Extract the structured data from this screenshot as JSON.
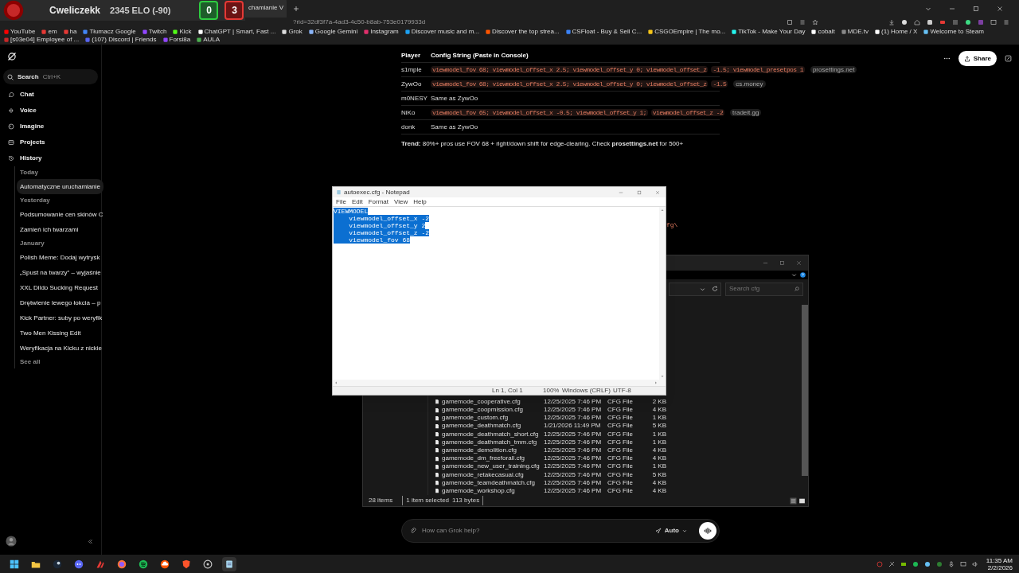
{
  "stream_overlay": {
    "name": "Cweliczekk",
    "elo": "2345 ELO (-90)",
    "wins": "0",
    "losses": "3"
  },
  "browser": {
    "tabs": [
      {
        "title": "chamianie V",
        "selected": true
      }
    ],
    "url": "?rid=32df3f7a-4ad3-4c50-b8ab-753e0179933d",
    "bookmarks": [
      {
        "label": "YouTube",
        "color": "#ff0000"
      },
      {
        "label": "em",
        "color": "#e53935"
      },
      {
        "label": "ha",
        "color": "#e53935"
      },
      {
        "label": "Tłumacz Google",
        "color": "#4285f4"
      },
      {
        "label": "Twitch",
        "color": "#9146ff"
      },
      {
        "label": "Kick",
        "color": "#53fc18"
      },
      {
        "label": "ChatGPT | Smart, Fast ...",
        "color": "#ffffff"
      },
      {
        "label": "Grok",
        "color": "#dddddd"
      },
      {
        "label": "Google Gemini",
        "color": "#8ab4f8"
      },
      {
        "label": "Instagram",
        "color": "#e1306c"
      },
      {
        "label": "Discover music and m...",
        "color": "#1da1f2"
      },
      {
        "label": "Discover the top strea...",
        "color": "#ff5500"
      },
      {
        "label": "CSFloat - Buy & Sell C...",
        "color": "#3b82f6"
      },
      {
        "label": "CSGOEmpire | The mo...",
        "color": "#f5c518"
      },
      {
        "label": "TikTok - Make Your Day",
        "color": "#25f4ee"
      },
      {
        "label": "cobalt",
        "color": "#ffffff"
      },
      {
        "label": "MDE.tv",
        "color": "#888888"
      },
      {
        "label": "(1) Home / X",
        "color": "#ffffff"
      },
      {
        "label": "Welcome to Steam",
        "color": "#66c0f4"
      },
      {
        "label": "[s03e04] Employee of ...",
        "color": "#c62828"
      },
      {
        "label": "(107) Discord | Friends",
        "color": "#5865f2"
      },
      {
        "label": "Forsi8a",
        "color": "#9146ff"
      },
      {
        "label": "AULA",
        "color": "#4caf50"
      }
    ]
  },
  "sidebar": {
    "search": {
      "label": "Search",
      "shortcut": "Ctrl+K"
    },
    "nav": [
      {
        "kind": "chat",
        "label": "Chat"
      },
      {
        "kind": "voice",
        "label": "Voice"
      },
      {
        "kind": "imagine",
        "label": "Imagine"
      },
      {
        "kind": "projects",
        "label": "Projects"
      },
      {
        "kind": "history",
        "label": "History"
      }
    ],
    "history": [
      {
        "heading": "Today",
        "items": [
          {
            "title": "Automatyczne uruchamianie",
            "selected": true
          }
        ]
      },
      {
        "heading": "Yesterday",
        "items": [
          {
            "title": "Podsumowanie cen skinów C",
            "selected": false
          },
          {
            "title": "Zamień ich twarzami",
            "selected": false
          }
        ]
      },
      {
        "heading": "January",
        "items": [
          {
            "title": "Polish Meme: Dodaj wytrysk",
            "selected": false
          },
          {
            "title": "„Spust na twarzy” – wyjaśnie",
            "selected": false
          },
          {
            "title": "XXL Dildo Sucking Request",
            "selected": false
          },
          {
            "title": "Drętwienie lewego łokcia – p",
            "selected": false
          },
          {
            "title": "Kick Partner: suby po weryfik",
            "selected": false
          },
          {
            "title": "Two Men Kissing Edit",
            "selected": false
          },
          {
            "title": "Weryfikacja na Kicku z nickie",
            "selected": false
          }
        ]
      }
    ],
    "see_all": "See all"
  },
  "header": {
    "share": "Share"
  },
  "chat": {
    "table": {
      "columns": [
        "Player",
        "Config String (Paste in Console)"
      ],
      "rows": [
        {
          "player": "s1mple",
          "parts": [
            {
              "kind": "code",
              "text": "viewmodel_fov 68; viewmodel_offset_x 2.5; viewmodel_offset_y 0; viewmodel_offset_z"
            },
            {
              "kind": "code",
              "text": "-1.5; viewmodel_presetpos 1"
            },
            {
              "kind": "source",
              "text": "prosettings.net"
            }
          ]
        },
        {
          "player": "ZywOo",
          "parts": [
            {
              "kind": "code",
              "text": "viewmodel_fov 68; viewmodel_offset_x 2.5; viewmodel_offset_y 0; viewmodel_offset_z"
            },
            {
              "kind": "code",
              "text": "-1.5"
            },
            {
              "kind": "source",
              "text": "cs.money"
            }
          ]
        },
        {
          "player": "m0NESY",
          "parts": [
            {
              "kind": "text",
              "text": "Same as ZywOo"
            }
          ]
        },
        {
          "player": "NiKo",
          "parts": [
            {
              "kind": "code",
              "text": "viewmodel_fov 65; viewmodel_offset_x -0.5; viewmodel_offset_y 1;"
            },
            {
              "kind": "code",
              "text": "viewmodel_offset_z -2"
            },
            {
              "kind": "source",
              "text": "tradeit.gg"
            }
          ]
        },
        {
          "player": "donk",
          "parts": [
            {
              "kind": "text",
              "text": "Same as ZywOo"
            }
          ]
        }
      ]
    },
    "trend": "**Trend:** 80%+ pros use FOV 68 + right/down shift for edge-clearing. Check **prosettings.net** for 500+",
    "partial_code": "fg\\"
  },
  "notepad": {
    "title": "autoexec.cfg - Notepad",
    "menu": [
      "File",
      "Edit",
      "Format",
      "View",
      "Help"
    ],
    "lines": [
      {
        "text": "VIEWMODEL",
        "selected": true
      },
      {
        "text": "    viewmodel_offset_x -2",
        "selected": true
      },
      {
        "text": "    viewmodel_offset_y 2",
        "selected": true
      },
      {
        "text": "    viewmodel_offset_z -2",
        "selected": true
      },
      {
        "text": "    viewmodel_fov 68",
        "selected": true
      }
    ],
    "status": [
      "Ln 1, Col 1",
      "100%",
      "Windows (CRLF)",
      "UTF-8"
    ]
  },
  "explorer": {
    "search_placeholder": "Search cfg",
    "files": [
      {
        "name": "gamemode_cooperative.cfg",
        "date": "12/25/2025 7:46 PM",
        "type": "CFG File",
        "size": "2 KB"
      },
      {
        "name": "gamemode_coopmission.cfg",
        "date": "12/25/2025 7:46 PM",
        "type": "CFG File",
        "size": "4 KB"
      },
      {
        "name": "gamemode_custom.cfg",
        "date": "12/25/2025 7:46 PM",
        "type": "CFG File",
        "size": "1 KB"
      },
      {
        "name": "gamemode_deathmatch.cfg",
        "date": "1/21/2026 11:49 PM",
        "type": "CFG File",
        "size": "5 KB"
      },
      {
        "name": "gamemode_deathmatch_short.cfg",
        "date": "12/25/2025 7:46 PM",
        "type": "CFG File",
        "size": "1 KB"
      },
      {
        "name": "gamemode_deathmatch_tmm.cfg",
        "date": "12/25/2025 7:46 PM",
        "type": "CFG File",
        "size": "1 KB"
      },
      {
        "name": "gamemode_demolition.cfg",
        "date": "12/25/2025 7:46 PM",
        "type": "CFG File",
        "size": "4 KB"
      },
      {
        "name": "gamemode_dm_freeforall.cfg",
        "date": "12/25/2025 7:46 PM",
        "type": "CFG File",
        "size": "4 KB"
      },
      {
        "name": "gamemode_new_user_training.cfg",
        "date": "12/25/2025 7:46 PM",
        "type": "CFG File",
        "size": "1 KB"
      },
      {
        "name": "gamemode_retakecasual.cfg",
        "date": "12/25/2025 7:46 PM",
        "type": "CFG File",
        "size": "5 KB"
      },
      {
        "name": "gamemode_teamdeathmatch.cfg",
        "date": "12/25/2025 7:46 PM",
        "type": "CFG File",
        "size": "4 KB"
      },
      {
        "name": "gamemode_workshop.cfg",
        "date": "12/25/2025 7:46 PM",
        "type": "CFG File",
        "size": "4 KB"
      }
    ],
    "status": [
      "28 items",
      "1 item selected",
      "113 bytes"
    ]
  },
  "composer": {
    "placeholder": "How can Grok help?",
    "mode": "Auto"
  },
  "taskbar": {
    "time": "11:35 AM",
    "date": "2/2/2026"
  }
}
